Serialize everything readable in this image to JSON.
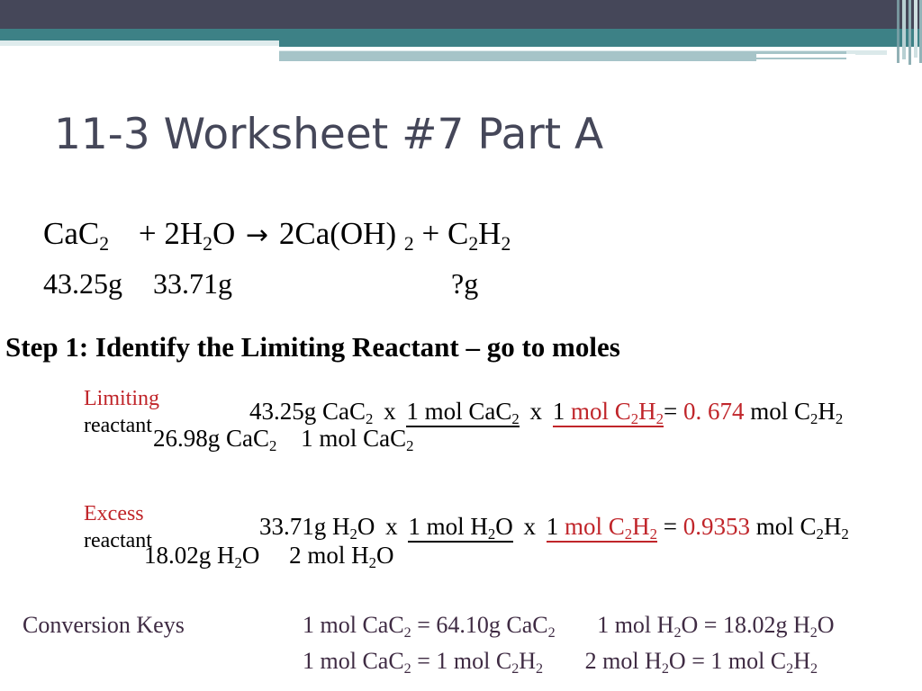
{
  "title": "11-3 Worksheet #7 Part A",
  "equation": {
    "reactant_1": "CaC",
    "reactant_1_sub": "2",
    "plus_1": "+",
    "reactant_2_coef": "2",
    "reactant_2_a": "H",
    "reactant_2_sub": "2",
    "reactant_2_b": "O",
    "arrow": "→",
    "product_1_coef": "2",
    "product_1": "Ca(OH)",
    "product_1_sub": "2",
    "plus_2": "+",
    "product_2_a": "C",
    "product_2_sub_a": "2",
    "product_2_b": "H",
    "product_2_sub_b": "2",
    "full_text": "CaC2 + 2H2O → 2Ca(OH)2 + C2H2"
  },
  "masses": {
    "mass_1": "43.25g",
    "mass_2": "33.71g",
    "mass_unknown": "?g"
  },
  "step_heading": "Step 1: Identify the Limiting Reactant – go to moles",
  "rows": [
    {
      "label_red": "Limiting",
      "label_black": "reactant",
      "given": "43.25g CaC",
      "given_sub": "2",
      "mul_1": "x",
      "f1_num_pre": "1 mol CaC",
      "f1_num_sub": "2",
      "f1_den_pre": "26.98g CaC",
      "f1_den_sub": "2",
      "mul_2": "x",
      "f2_num_black": "1",
      "f2_num_red_pre": "mol C",
      "f2_num_red_sub_a": "2",
      "f2_num_red_mid": "H",
      "f2_num_red_sub_b": "2",
      "f2_den_pre": "1 mol CaC",
      "f2_den_sub": "2",
      "equals": "=",
      "result": "0. 674",
      "result_unit_pre": "mol C",
      "result_unit_sub_a": "2",
      "result_unit_mid": "H",
      "result_unit_sub_b": "2"
    },
    {
      "label_red": "Excess",
      "label_black": "reactant",
      "given": "33.71g H",
      "given_sub": "2",
      "given_post": "O",
      "mul_1": "x",
      "f1_num_pre": "1 mol H",
      "f1_num_sub": "2",
      "f1_num_post": "O",
      "f1_den_pre": "18.02g H",
      "f1_den_sub": "2",
      "f1_den_post": "O",
      "mul_2": "x",
      "f2_num_black": "1",
      "f2_num_red_pre": "mol C",
      "f2_num_red_sub_a": "2",
      "f2_num_red_mid": "H",
      "f2_num_red_sub_b": "2",
      "f2_den_pre": "2 mol H",
      "f2_den_sub": "2",
      "f2_den_post": "O",
      "equals": "=",
      "result": "0.9353",
      "result_unit_pre": "mol C",
      "result_unit_sub_a": "2",
      "result_unit_mid": "H",
      "result_unit_sub_b": "2"
    }
  ],
  "conversion_keys": {
    "title": "Conversion Keys",
    "row_1": {
      "left_a": "1 mol CaC",
      "left_a_sub": "2",
      "left_eq": "=",
      "left_b": "64.10g CaC",
      "left_b_sub": "2",
      "right_a": "1 mol H",
      "right_a_sub": "2",
      "right_a_post": "O",
      "right_eq": "=",
      "right_b": "18.02g H",
      "right_b_sub": "2",
      "right_b_post": "O"
    },
    "row_2": {
      "left_a": "1 mol CaC",
      "left_a_sub": "2",
      "left_eq": "=",
      "left_b": "1 mol C",
      "left_b_sub": "2",
      "left_b_mid": "H",
      "left_b_sub_2": "2",
      "right_a": "2 mol H",
      "right_a_sub": "2",
      "right_a_post": "O",
      "right_eq": "=",
      "right_b": "1 mol C",
      "right_b_sub": "2",
      "right_b_mid": "H",
      "right_b_sub_2": "2"
    }
  },
  "colors": {
    "header_dark": "#454759",
    "header_teal": "#3d8186",
    "header_light": "#a6c4c8",
    "accent_red": "#c0252a",
    "keys_purple": "#3f2b43"
  }
}
